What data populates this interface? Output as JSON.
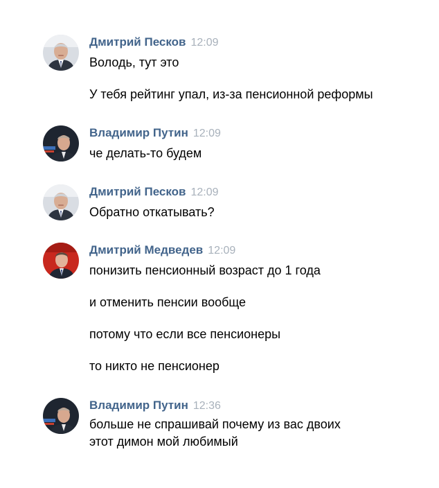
{
  "messages": [
    {
      "author": "Дмитрий Песков",
      "time": "12:09",
      "avatar_icon": "peskov-avatar",
      "lines": [
        "Володь, тут это",
        "У тебя рейтинг упал, из-за пенсионной реформы"
      ]
    },
    {
      "author": "Владимир Путин",
      "time": "12:09",
      "avatar_icon": "putin-avatar",
      "lines": [
        "че делать-то будем"
      ]
    },
    {
      "author": "Дмитрий Песков",
      "time": "12:09",
      "avatar_icon": "peskov-avatar",
      "lines": [
        "Обратно откатывать?"
      ]
    },
    {
      "author": "Дмитрий Медведев",
      "time": "12:09",
      "avatar_icon": "medvedev-avatar",
      "lines": [
        "понизить пенсионный возраст до 1 года",
        "и отменить пенсии вообще",
        "потому что если все пенсионеры",
        "то никто не пенсионер"
      ]
    },
    {
      "author": "Владимир Путин",
      "time": "12:36",
      "avatar_icon": "putin-avatar",
      "lines": [
        "больше не спрашивай почему из вас двоих",
        "этот димон мой любимый"
      ]
    }
  ],
  "colors": {
    "author": "#42648b",
    "time": "#a8b1bb",
    "text": "#000000"
  }
}
